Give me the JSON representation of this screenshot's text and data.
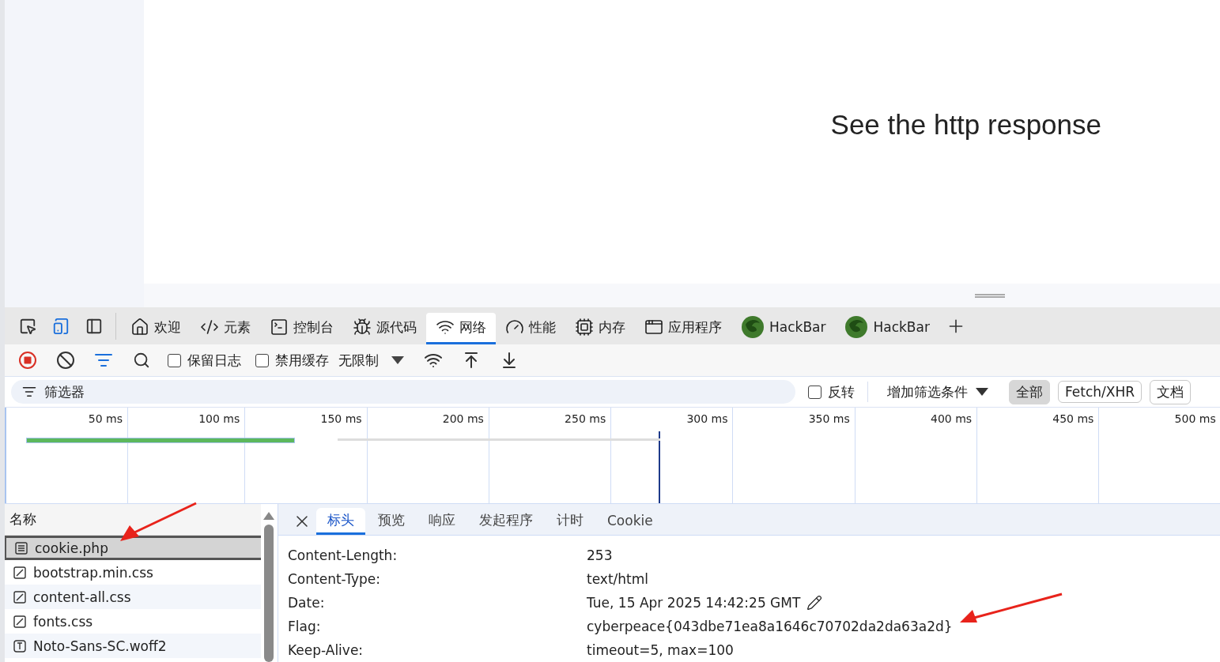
{
  "page": {
    "heading": "See the http response"
  },
  "devtools": {
    "tabs": [
      {
        "label": "欢迎",
        "selected": false
      },
      {
        "label": "元素",
        "selected": false
      },
      {
        "label": "控制台",
        "selected": false
      },
      {
        "label": "源代码",
        "selected": false
      },
      {
        "label": "网络",
        "selected": true
      },
      {
        "label": "性能",
        "selected": false
      },
      {
        "label": "内存",
        "selected": false
      },
      {
        "label": "应用程序",
        "selected": false
      },
      {
        "label": "HackBar",
        "selected": false
      },
      {
        "label": "HackBar",
        "selected": false
      }
    ],
    "network_toolbar": {
      "recording": true,
      "checkboxes": [
        {
          "label": "保留日志",
          "checked": false
        },
        {
          "label": "禁用缓存",
          "checked": false
        }
      ],
      "throttling": "无限制"
    },
    "filter_bar": {
      "placeholder": "筛选器",
      "invert": {
        "label": "反转",
        "checked": false
      },
      "more_filters": "增加筛选条件",
      "type_filters": [
        {
          "label": "全部",
          "selected": true
        },
        {
          "label": "Fetch/XHR",
          "selected": false
        },
        {
          "label": "文档",
          "selected": false
        }
      ]
    },
    "timeline": {
      "ticks": [
        "50 ms",
        "100 ms",
        "150 ms",
        "200 ms",
        "250 ms",
        "300 ms",
        "350 ms",
        "400 ms",
        "450 ms",
        "500 ms"
      ]
    },
    "requests": {
      "header": "名称",
      "rows": [
        {
          "name": "cookie.php",
          "kind": "document",
          "selected": true
        },
        {
          "name": "bootstrap.min.css",
          "kind": "stylesheet",
          "selected": false
        },
        {
          "name": "content-all.css",
          "kind": "stylesheet",
          "selected": false
        },
        {
          "name": "fonts.css",
          "kind": "stylesheet",
          "selected": false
        },
        {
          "name": "Noto-Sans-SC.woff2",
          "kind": "font",
          "selected": false
        }
      ]
    },
    "details": {
      "tabs": [
        {
          "label": "标头",
          "selected": true
        },
        {
          "label": "预览",
          "selected": false
        },
        {
          "label": "响应",
          "selected": false
        },
        {
          "label": "发起程序",
          "selected": false
        },
        {
          "label": "计时",
          "selected": false
        },
        {
          "label": "Cookie",
          "selected": false
        }
      ],
      "headers": [
        {
          "name": "Content-Length:",
          "value": "253",
          "editable": false
        },
        {
          "name": "Content-Type:",
          "value": "text/html",
          "editable": false
        },
        {
          "name": "Date:",
          "value": "Tue, 15 Apr 2025 14:42:25 GMT",
          "editable": true
        },
        {
          "name": "Flag:",
          "value": "cyberpeace{043dbe71ea8a1646c70702da2da63a2d}",
          "editable": false
        },
        {
          "name": "Keep-Alive:",
          "value": "timeout=5, max=100",
          "editable": false
        }
      ]
    }
  }
}
